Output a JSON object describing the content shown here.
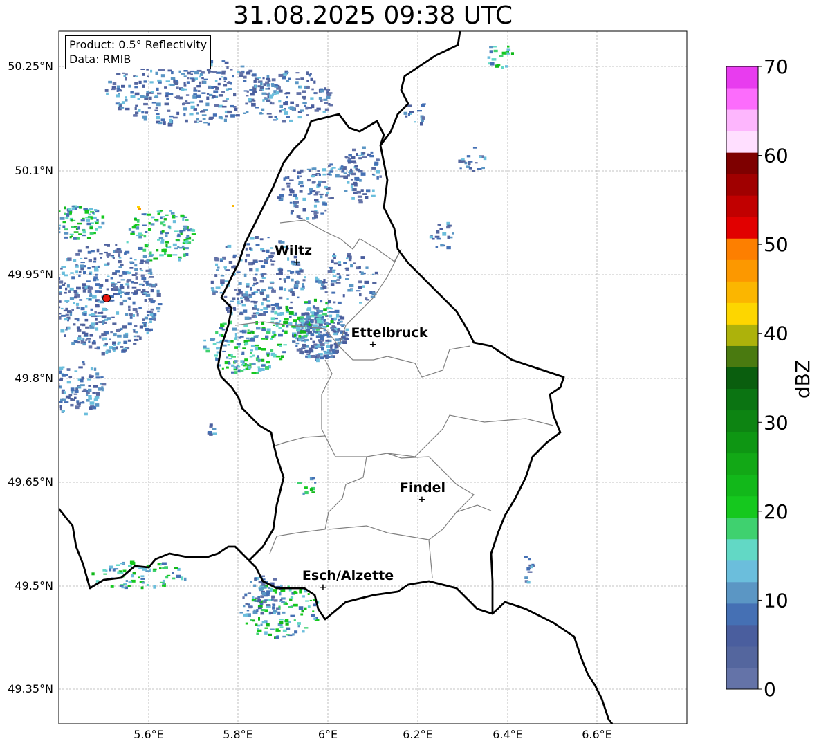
{
  "title": "31.08.2025 09:38 UTC",
  "info_box": {
    "product": "Product: 0.5° Reflectivity",
    "data_source": "Data: RMIB"
  },
  "map": {
    "lat_ticks": [
      "50.25°N",
      "50.1°N",
      "49.95°N",
      "49.8°N",
      "49.65°N",
      "49.5°N",
      "49.35°N"
    ],
    "lon_ticks": [
      "5.6°E",
      "5.8°E",
      "6°E",
      "6.2°E",
      "6.4°E",
      "6.6°E"
    ],
    "cities": [
      {
        "name": "Wiltz"
      },
      {
        "name": "Ettelbruck"
      },
      {
        "name": "Findel"
      },
      {
        "name": "Esch/Alzette"
      }
    ],
    "radar_site_color": "#e8150f",
    "national_border_color": "#000000",
    "district_border_color": "#808080"
  },
  "colorbar": {
    "label": "dBZ",
    "tick_labels": [
      "0",
      "10",
      "20",
      "30",
      "40",
      "50",
      "60",
      "70"
    ],
    "colors": [
      "#6473a8",
      "#54669e",
      "#4a5e9e",
      "#4570b4",
      "#5b96c4",
      "#6bbedc",
      "#62d8c5",
      "#3fd16f",
      "#15c81e",
      "#12b81a",
      "#12a816",
      "#0e9613",
      "#0d8412",
      "#0b7412",
      "#0a5e0e",
      "#4a7a10",
      "#adb20b",
      "#fdd600",
      "#fbb600",
      "#fc9800",
      "#fd7f00",
      "#e10000",
      "#c10000",
      "#a00000",
      "#7e0000",
      "#ffdfff",
      "#fdb6fd",
      "#fc6cfc",
      "#e83cef"
    ]
  }
}
